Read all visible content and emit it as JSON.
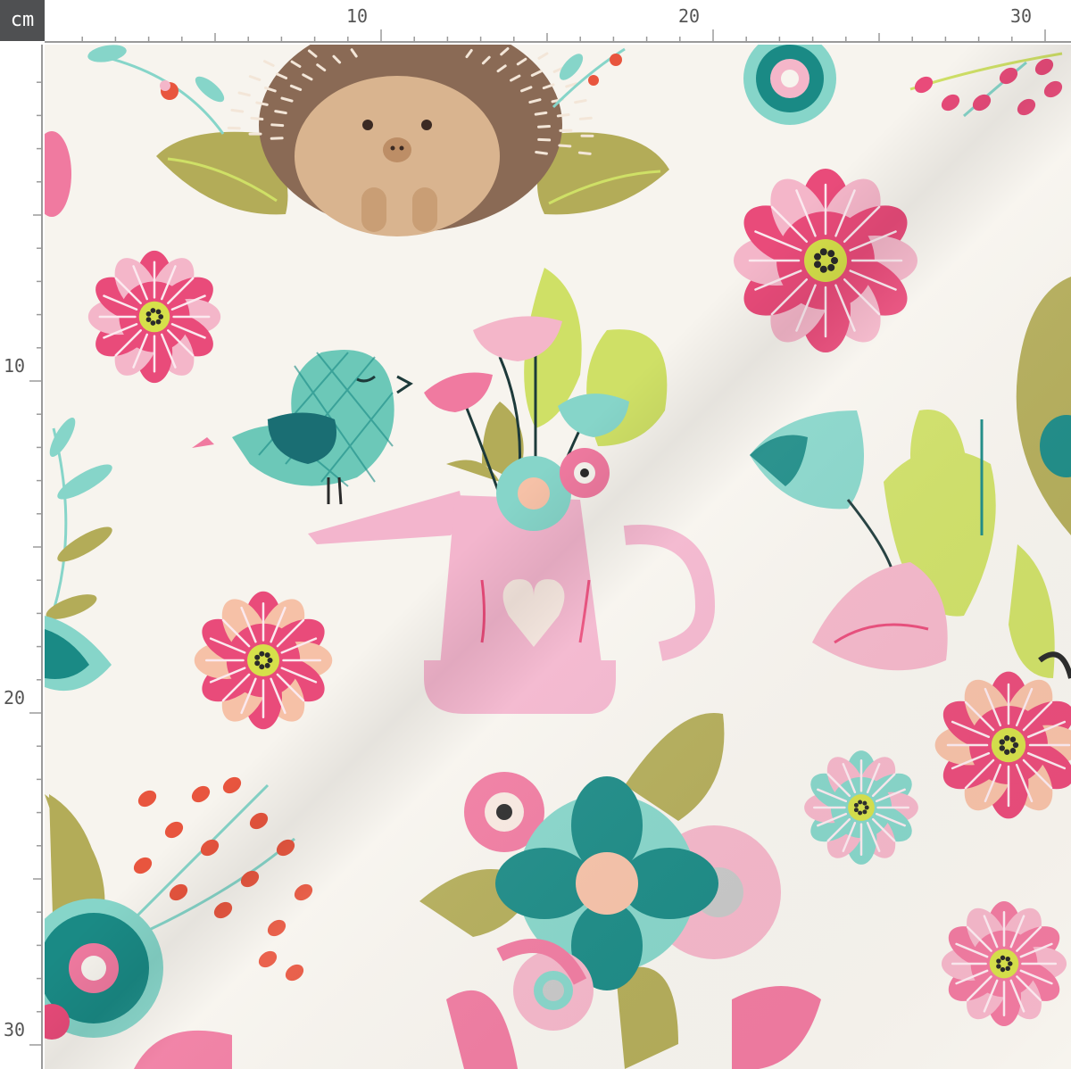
{
  "ruler": {
    "unit": "cm",
    "top_labels": [
      "10",
      "20",
      "30"
    ],
    "left_labels": [
      "10",
      "20",
      "30"
    ]
  },
  "palette": {
    "background": "#f7f4ee",
    "pink": "#e94b7a",
    "light_pink": "#f4b6c9",
    "teal": "#1a8a85",
    "mint": "#86d5c9",
    "olive": "#b3ac58",
    "lime": "#cfe066",
    "brown": "#8a6a55",
    "tan": "#d9b48f",
    "coral": "#e8553e",
    "can_pink": "#f3b5cd"
  },
  "motifs": {
    "hedgehog": "hedgehog-illustration",
    "bird": "bird-illustration",
    "watering_can": "watering-can-illustration",
    "heart": "heart-icon"
  }
}
